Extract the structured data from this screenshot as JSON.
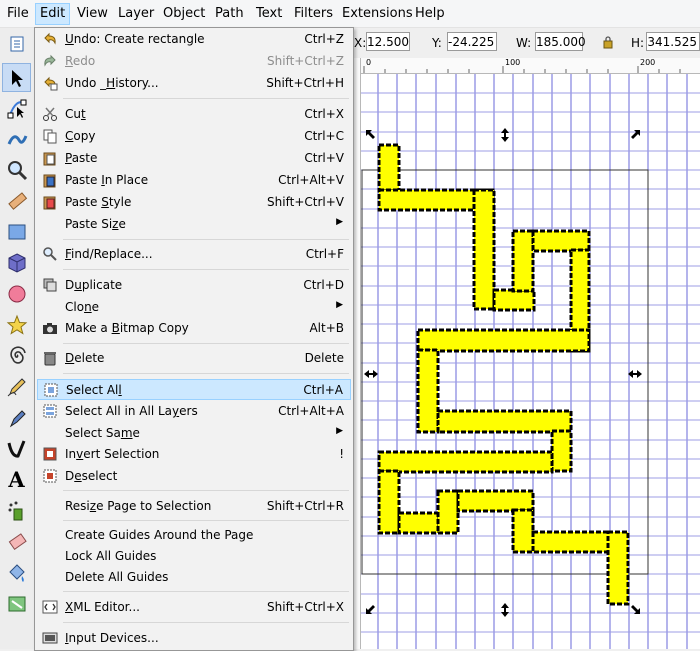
{
  "menubar": {
    "items": [
      "File",
      "Edit",
      "View",
      "Layer",
      "Object",
      "Path",
      "Text",
      "Filters",
      "Extensions",
      "Help"
    ],
    "active": "Edit"
  },
  "controls": {
    "x_label": "X:",
    "x_value": "12.500",
    "y_label": "Y:",
    "y_value": "-24.225",
    "w_label": "W:",
    "w_value": "185.000",
    "h_label": "H:",
    "h_value": "341.525"
  },
  "ruler": {
    "h_ticks": [
      "0",
      "100",
      "200"
    ]
  },
  "menu": {
    "items": [
      {
        "label": "Undo: Create rectangle",
        "shortcut": "Ctrl+Z",
        "icon": "undo-icon",
        "enabled": true
      },
      {
        "label": "Redo",
        "shortcut": "Shift+Ctrl+Z",
        "icon": "redo-icon",
        "enabled": false
      },
      {
        "label": "Undo History...",
        "shortcut": "Shift+Ctrl+H",
        "icon": "undo-history-icon",
        "enabled": true
      },
      {
        "label": "Cut",
        "shortcut": "Ctrl+X",
        "icon": "cut-icon",
        "enabled": true
      },
      {
        "label": "Copy",
        "shortcut": "Ctrl+C",
        "icon": "copy-icon",
        "enabled": true
      },
      {
        "label": "Paste",
        "shortcut": "Ctrl+V",
        "icon": "paste-icon",
        "enabled": true
      },
      {
        "label": "Paste In Place",
        "shortcut": "Ctrl+Alt+V",
        "icon": "paste-in-place-icon",
        "enabled": true
      },
      {
        "label": "Paste Style",
        "shortcut": "Shift+Ctrl+V",
        "icon": "paste-style-icon",
        "enabled": true
      },
      {
        "label": "Paste Size",
        "shortcut": "",
        "icon": "",
        "enabled": true,
        "submenu": true
      },
      {
        "label": "Find/Replace...",
        "shortcut": "Ctrl+F",
        "icon": "find-icon",
        "enabled": true
      },
      {
        "label": "Duplicate",
        "shortcut": "Ctrl+D",
        "icon": "duplicate-icon",
        "enabled": true
      },
      {
        "label": "Clone",
        "shortcut": "",
        "icon": "",
        "enabled": true,
        "submenu": true
      },
      {
        "label": "Make a Bitmap Copy",
        "shortcut": "Alt+B",
        "icon": "camera-icon",
        "enabled": true
      },
      {
        "label": "Delete",
        "shortcut": "Delete",
        "icon": "trash-icon",
        "enabled": true
      },
      {
        "label": "Select All",
        "shortcut": "Ctrl+A",
        "icon": "select-all-icon",
        "enabled": true,
        "highlighted": true
      },
      {
        "label": "Select All in All Layers",
        "shortcut": "Ctrl+Alt+A",
        "icon": "select-all-layers-icon",
        "enabled": true
      },
      {
        "label": "Select Same",
        "shortcut": "",
        "icon": "",
        "enabled": true,
        "submenu": true
      },
      {
        "label": "Invert Selection",
        "shortcut": "!",
        "icon": "invert-selection-icon",
        "enabled": true
      },
      {
        "label": "Deselect",
        "shortcut": "",
        "icon": "deselect-icon",
        "enabled": true
      },
      {
        "label": "Resize Page to Selection",
        "shortcut": "Shift+Ctrl+R",
        "icon": "",
        "enabled": true
      },
      {
        "label": "Create Guides Around the Page",
        "shortcut": "",
        "icon": "",
        "enabled": true
      },
      {
        "label": "Lock All Guides",
        "shortcut": "",
        "icon": "",
        "enabled": true
      },
      {
        "label": "Delete All Guides",
        "shortcut": "",
        "icon": "",
        "enabled": true
      },
      {
        "label": "XML Editor...",
        "shortcut": "Shift+Ctrl+X",
        "icon": "xml-editor-icon",
        "enabled": true
      },
      {
        "label": "Input Devices...",
        "shortcut": "",
        "icon": "input-devices-icon",
        "enabled": true
      }
    ]
  },
  "toolbox": [
    "selector-tool-icon",
    "node-tool-icon",
    "tweak-tool-icon",
    "zoom-tool-icon",
    "measure-tool-icon",
    "rectangle-tool-icon",
    "3d-box-tool-icon",
    "ellipse-tool-icon",
    "star-tool-icon",
    "spiral-tool-icon",
    "pencil-tool-icon",
    "pen-tool-icon",
    "calligraphy-tool-icon",
    "text-tool-icon",
    "spray-tool-icon",
    "eraser-tool-icon",
    "paint-bucket-tool-icon",
    "gradient-tool-icon"
  ],
  "colors": {
    "shape_fill": "#ffff00",
    "shape_stroke": "#000000",
    "grid": "#5b5bd6",
    "menu_highlight": "#cce8ff"
  }
}
